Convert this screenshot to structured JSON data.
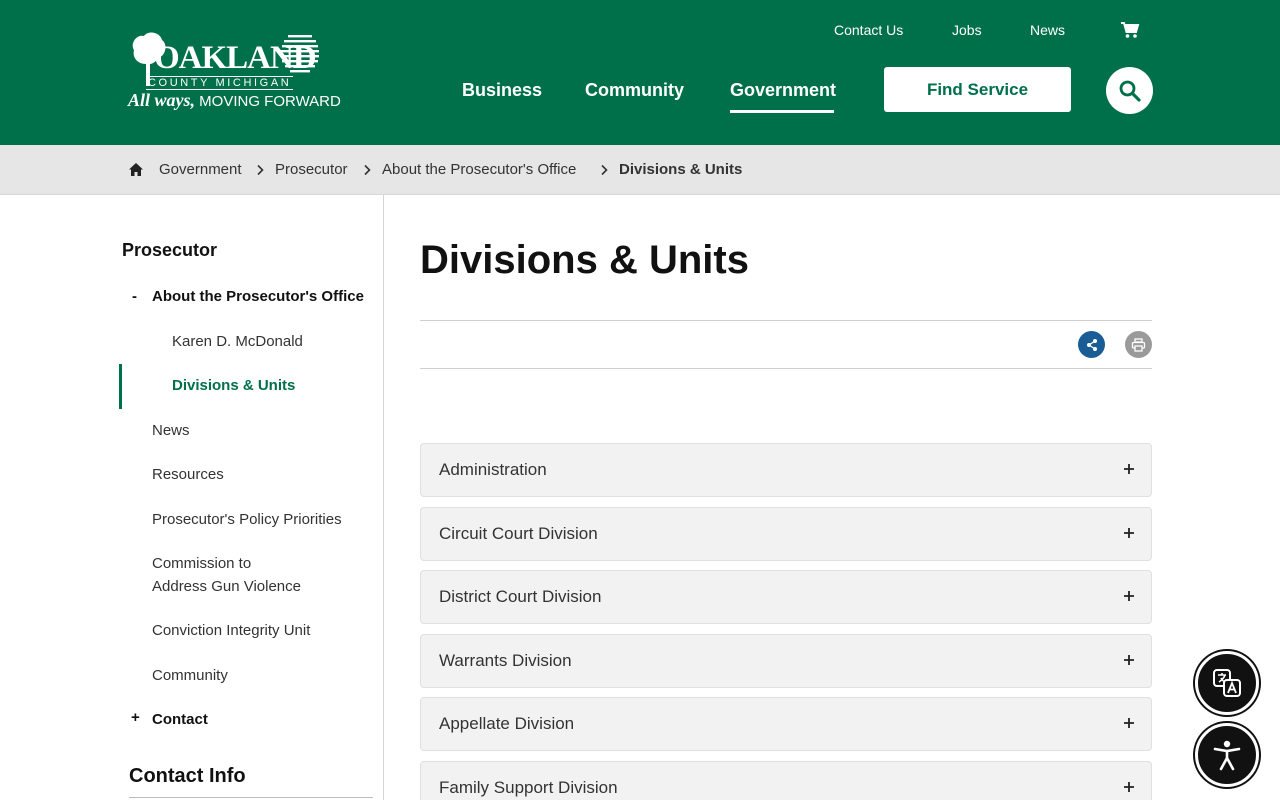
{
  "brand": {
    "logo_word": "OAKLAND",
    "logo_sub": "COUNTY MICHIGAN",
    "tag_script": "All ways,",
    "tag_text": " MOVING FORWARD"
  },
  "utility_nav": {
    "contact": "Contact Us",
    "jobs": "Jobs",
    "news": "News"
  },
  "main_nav": {
    "business": "Business",
    "community": "Community",
    "government": "Government",
    "find_service": "Find Service"
  },
  "breadcrumb": [
    "Government",
    "Prosecutor",
    "About the Prosecutor's Office",
    "Divisions & Units"
  ],
  "sidebar": {
    "title": "Prosecutor",
    "items": [
      {
        "label": "About the Prosecutor's Office",
        "toggle": "-"
      },
      {
        "label": "Karen D. McDonald"
      },
      {
        "label": "Divisions & Units"
      },
      {
        "label": "News"
      },
      {
        "label": "Resources"
      },
      {
        "label": "Prosecutor's Policy Priorities"
      },
      {
        "label": "Commission to"
      },
      {
        "label": "Address Gun Violence"
      },
      {
        "label": "Conviction Integrity Unit"
      },
      {
        "label": "Community"
      },
      {
        "label": "Contact",
        "toggle": "+"
      }
    ],
    "contact_info": "Contact Info"
  },
  "main": {
    "title": "Divisions & Units",
    "accordions": [
      "Administration",
      "Circuit Court Division",
      "District Court Division",
      "Warrants Division",
      "Appellate Division",
      "Family Support Division"
    ]
  },
  "colors": {
    "brand_green": "#00704a",
    "share_blue": "#1a5d96",
    "breadcrumb_bg": "#e6e6e6"
  },
  "icons": [
    "cart-icon",
    "search-icon",
    "home-icon",
    "chevron-right-icon",
    "share-icon",
    "print-icon",
    "plus-icon",
    "translate-icon",
    "accessibility-icon"
  ]
}
